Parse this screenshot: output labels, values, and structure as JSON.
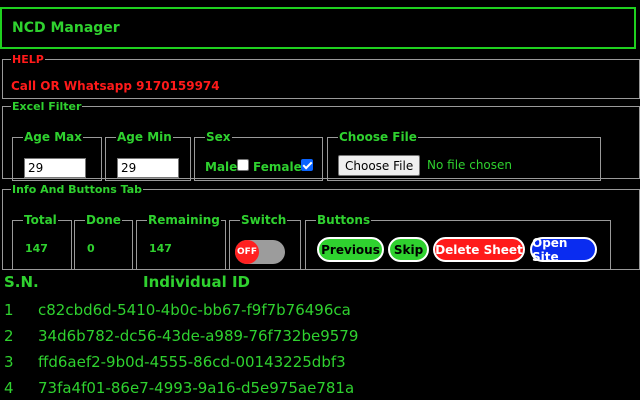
{
  "app": {
    "title": "NCD Manager"
  },
  "help": {
    "legend": "HELP",
    "text": "Call OR Whatsapp 9170159974"
  },
  "excel_filter": {
    "legend": "Excel Filter",
    "age_max": {
      "label": "Age Max",
      "value": "29"
    },
    "age_min": {
      "label": "Age Min",
      "value": "29"
    },
    "sex": {
      "label": "Sex",
      "male_label": "Male",
      "male_checked": false,
      "female_label": "Female",
      "female_checked": true
    },
    "file": {
      "label": "Choose File",
      "button_label": "Choose File",
      "status": "No file chosen"
    }
  },
  "info_tab": {
    "legend": "Info And Buttons Tab",
    "total": {
      "label": "Total",
      "value": "147"
    },
    "done": {
      "label": "Done",
      "value": "0"
    },
    "remaining": {
      "label": "Remaining",
      "value": "147"
    },
    "switch": {
      "label": "Switch",
      "state_label": "OFF"
    },
    "buttons": {
      "label": "Buttons",
      "previous": "Previous",
      "skip": "Skip",
      "delete_sheet": "Delete Sheet",
      "open_site": "Open Site"
    }
  },
  "records": {
    "headers": {
      "sn": "S.N.",
      "id": "Individual ID"
    },
    "rows": [
      {
        "sn": "1",
        "id": "c82cbd6d-5410-4b0c-bb67-f9f7b76496ca"
      },
      {
        "sn": "2",
        "id": "34d6b782-dc56-43de-a989-76f732be9579"
      },
      {
        "sn": "3",
        "id": "ffd6aef2-9b0d-4555-86cd-00143225dbf3"
      },
      {
        "sn": "4",
        "id": "73fa4f01-86e7-4993-9a16-d5e975ae781a"
      }
    ]
  },
  "colors": {
    "accent_green": "#2fd12f",
    "alert_red": "#ff1a1a",
    "link_blue": "#0a2cf0",
    "background": "#000000"
  }
}
